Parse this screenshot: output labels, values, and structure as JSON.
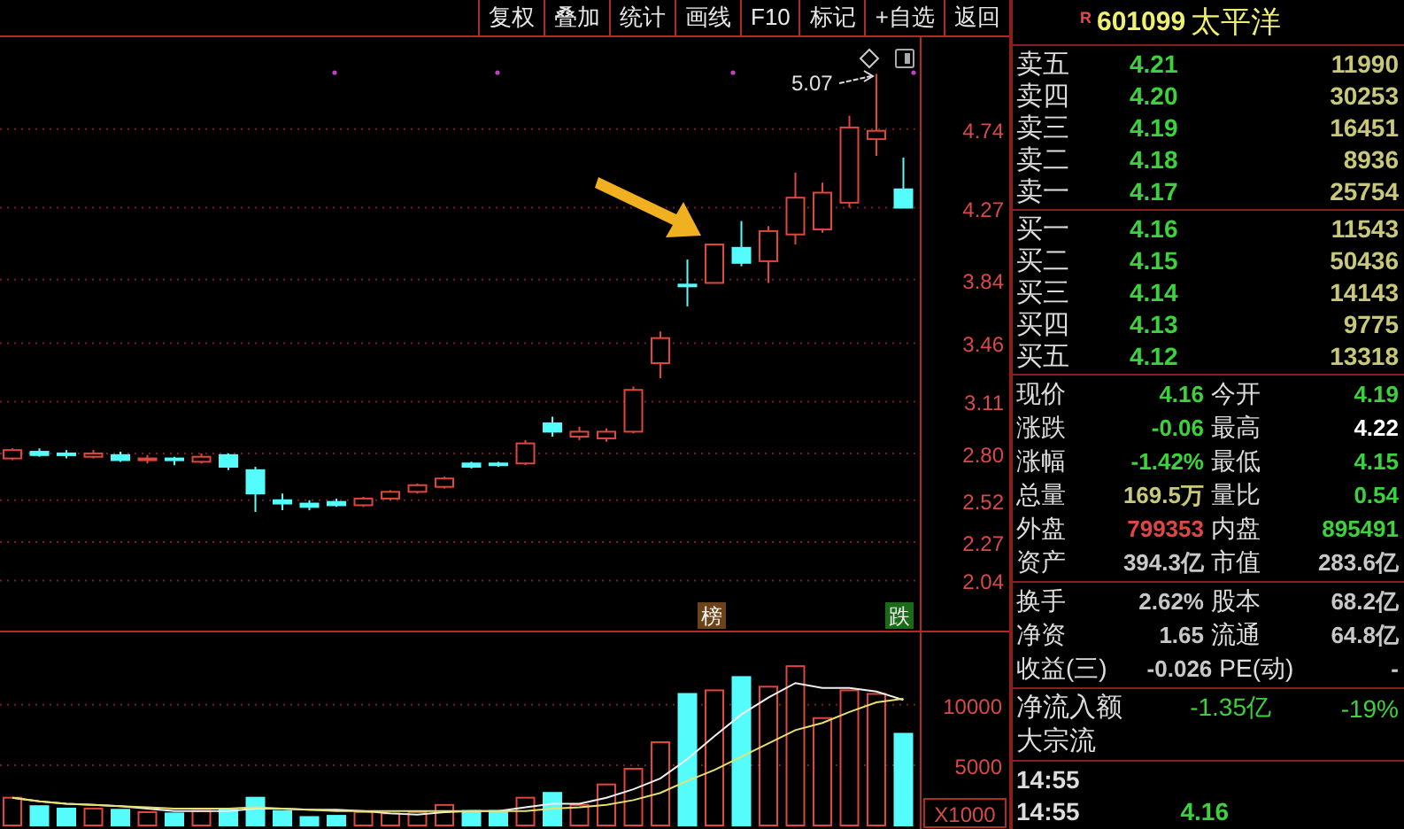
{
  "toolbar": {
    "buttons": [
      "复权",
      "叠加",
      "统计",
      "画线",
      "F10",
      "标记",
      "+自选",
      "返回"
    ]
  },
  "price_chart": {
    "chart_data": {
      "type": "candlestick",
      "grid": true,
      "ylim": [
        1.74,
        5.29
      ],
      "yticks": [
        4.74,
        4.27,
        3.84,
        3.46,
        3.11,
        {
          "value": 2.8,
          "label": "2.80"
        },
        2.52,
        2.27,
        2.04
      ],
      "ohlc": [
        [
          2.77,
          2.83,
          2.76,
          2.82
        ],
        [
          2.81,
          2.83,
          2.78,
          2.79
        ],
        [
          2.8,
          2.82,
          2.77,
          2.79
        ],
        [
          2.78,
          2.82,
          2.77,
          2.8
        ],
        [
          2.79,
          2.81,
          2.75,
          2.76
        ],
        [
          2.76,
          2.79,
          2.74,
          2.77
        ],
        [
          2.77,
          2.78,
          2.73,
          2.76
        ],
        [
          2.75,
          2.8,
          2.74,
          2.78
        ],
        [
          2.79,
          2.8,
          2.7,
          2.72
        ],
        [
          2.7,
          2.72,
          2.45,
          2.56
        ],
        [
          2.52,
          2.56,
          2.46,
          2.5
        ],
        [
          2.5,
          2.52,
          2.46,
          2.48
        ],
        [
          2.51,
          2.53,
          2.48,
          2.49
        ],
        [
          2.49,
          2.54,
          2.48,
          2.53
        ],
        [
          2.53,
          2.58,
          2.52,
          2.57
        ],
        [
          2.57,
          2.62,
          2.56,
          2.61
        ],
        [
          2.6,
          2.66,
          2.59,
          2.65
        ],
        [
          2.74,
          2.75,
          2.71,
          2.72
        ],
        [
          2.74,
          2.75,
          2.72,
          2.73
        ],
        [
          2.74,
          2.88,
          2.73,
          2.86
        ],
        [
          2.98,
          3.02,
          2.9,
          2.93
        ],
        [
          2.9,
          2.96,
          2.88,
          2.93
        ],
        [
          2.89,
          2.95,
          2.87,
          2.93
        ],
        [
          2.93,
          3.2,
          2.92,
          3.18
        ],
        [
          3.34,
          3.53,
          3.25,
          3.49
        ],
        [
          3.81,
          3.96,
          3.68,
          3.8
        ],
        [
          3.82,
          4.05,
          3.82,
          4.05
        ],
        [
          4.03,
          4.19,
          3.92,
          3.94
        ],
        [
          3.95,
          4.16,
          3.82,
          4.13
        ],
        [
          4.11,
          4.48,
          4.05,
          4.33
        ],
        [
          4.14,
          4.42,
          4.12,
          4.36
        ],
        [
          4.3,
          4.82,
          4.27,
          4.75
        ],
        [
          4.68,
          5.07,
          4.58,
          4.73
        ],
        [
          4.38,
          4.57,
          4.27,
          4.27
        ]
      ]
    },
    "high_marker": "5.07",
    "badges": [
      {
        "text": "榜",
        "kind": "rank"
      },
      {
        "text": "跌",
        "kind": "fall"
      }
    ]
  },
  "volume_chart": {
    "unit": "X1000",
    "chart_data": {
      "type": "bar",
      "grid": true,
      "ylim": [
        0,
        16000
      ],
      "yticks": [
        5000,
        10000
      ],
      "series": [
        {
          "color": "#e0463c",
          "values": [
            2300,
            null,
            null,
            1400,
            null,
            1100,
            null,
            1200,
            null,
            null,
            null,
            null,
            null,
            1100,
            1000,
            1100,
            1700,
            null,
            null,
            2300,
            null,
            1700,
            3400,
            4700,
            6900,
            null,
            11200,
            null,
            11500,
            13200,
            8900,
            11200,
            10900,
            null
          ]
        },
        {
          "color": "#54fcfc",
          "values": [
            null,
            1600,
            1400,
            null,
            1300,
            null,
            1000,
            null,
            1300,
            2300,
            1200,
            700,
            800,
            null,
            null,
            null,
            null,
            1200,
            1200,
            null,
            2700,
            null,
            null,
            null,
            null,
            10900,
            null,
            12300,
            null,
            null,
            null,
            null,
            null,
            7600
          ]
        },
        {
          "type": "line",
          "color": "#f0f0f0",
          "values": [
            2300,
            2000,
            1800,
            1700,
            1600,
            1400,
            1200,
            1200,
            1200,
            1400,
            1400,
            1300,
            1300,
            1200,
            1000,
            900,
            1100,
            1200,
            1200,
            1500,
            1800,
            1800,
            2300,
            3000,
            3900,
            5500,
            7400,
            9200,
            10600,
            11800,
            11400,
            11400,
            11100,
            10400
          ]
        },
        {
          "type": "line",
          "color": "#e8e070",
          "values": [
            2300,
            2000,
            1800,
            1700,
            1600,
            1500,
            1400,
            1400,
            1400,
            1500,
            1400,
            1300,
            1200,
            1200,
            1200,
            1200,
            1200,
            1200,
            1200,
            1200,
            1400,
            1500,
            1700,
            2100,
            2700,
            3700,
            4600,
            5700,
            6800,
            7900,
            8500,
            9400,
            10200,
            10500
          ]
        }
      ]
    }
  },
  "quote": {
    "badge": "R",
    "code": "601099",
    "name": "太平洋"
  },
  "order_book": {
    "sell": [
      {
        "label": "卖五",
        "price": "4.21",
        "volume": "11990"
      },
      {
        "label": "卖四",
        "price": "4.20",
        "volume": "30253"
      },
      {
        "label": "卖三",
        "price": "4.19",
        "volume": "16451"
      },
      {
        "label": "卖二",
        "price": "4.18",
        "volume": "8936"
      },
      {
        "label": "卖一",
        "price": "4.17",
        "volume": "25754"
      }
    ],
    "buy": [
      {
        "label": "买一",
        "price": "4.16",
        "volume": "11543"
      },
      {
        "label": "买二",
        "price": "4.15",
        "volume": "50436"
      },
      {
        "label": "买三",
        "price": "4.14",
        "volume": "14143"
      },
      {
        "label": "买四",
        "price": "4.13",
        "volume": "9775"
      },
      {
        "label": "买五",
        "price": "4.12",
        "volume": "13318"
      }
    ]
  },
  "stats": [
    [
      [
        {
          "label": "现价",
          "value": "4.16",
          "color": "#3cd23c"
        },
        {
          "label": "今开",
          "value": "4.19",
          "color": "#3cd23c"
        }
      ],
      [
        {
          "label": "涨跌",
          "value": "-0.06",
          "color": "#3cd23c"
        },
        {
          "label": "最高",
          "value": "4.22",
          "color": "#ffffff"
        }
      ],
      [
        {
          "label": "涨幅",
          "value": "-1.42%",
          "color": "#3cd23c"
        },
        {
          "label": "最低",
          "value": "4.15",
          "color": "#3cd23c"
        }
      ],
      [
        {
          "label": "总量",
          "value": "169.5万",
          "color": "#c8c878"
        },
        {
          "label": "量比",
          "value": "0.54",
          "color": "#3cd23c"
        }
      ],
      [
        {
          "label": "外盘",
          "value": "799353",
          "color": "#e04646"
        },
        {
          "label": "内盘",
          "value": "895491",
          "color": "#3cd23c"
        }
      ],
      [
        {
          "label": "资产",
          "value": "394.3亿",
          "color": "#c8c8c8"
        },
        {
          "label": "市值",
          "value": "283.6亿",
          "color": "#c8c8c8"
        }
      ]
    ],
    [
      [
        {
          "label": "换手",
          "value": "2.62%",
          "color": "#c8c8c8"
        },
        {
          "label": "股本",
          "value": "68.2亿",
          "color": "#c8c8c8"
        }
      ],
      [
        {
          "label": "净资",
          "value": "1.65",
          "color": "#c8c8c8"
        },
        {
          "label": "流通",
          "value": "64.8亿",
          "color": "#c8c8c8"
        }
      ],
      [
        {
          "label": "收益(三)",
          "value": "-0.026",
          "color": "#c8c8c8"
        },
        {
          "label": "PE(动)",
          "value": "-",
          "color": "#c8c8c8"
        }
      ]
    ]
  ],
  "flow": [
    {
      "label": "净流入额",
      "value": "-1.35亿",
      "percent": "-19%"
    },
    {
      "label": "大宗流"
    }
  ],
  "ticks_list": [
    {
      "time": "14:55"
    },
    {
      "time": "14:55",
      "price": "4.16"
    }
  ]
}
